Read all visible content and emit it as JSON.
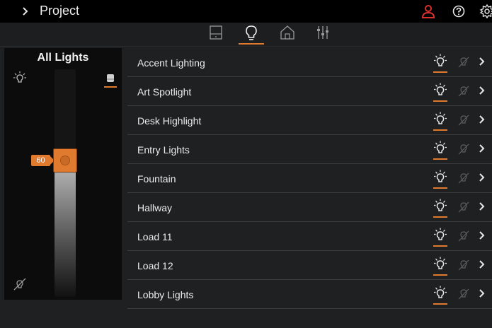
{
  "header": {
    "title": "Project"
  },
  "tabs": [
    {
      "icon": "keypad-icon",
      "active": false
    },
    {
      "icon": "lightbulb-icon",
      "active": true
    },
    {
      "icon": "house-icon",
      "active": false
    },
    {
      "icon": "sliders-icon",
      "active": false
    }
  ],
  "left_panel": {
    "title": "All Lights",
    "level": "60",
    "level_fraction": 0.6
  },
  "lights": [
    {
      "name": "Accent Lighting"
    },
    {
      "name": "Art Spotlight"
    },
    {
      "name": "Desk Highlight"
    },
    {
      "name": "Entry Lights"
    },
    {
      "name": "Fountain"
    },
    {
      "name": "Hallway"
    },
    {
      "name": "Load 11"
    },
    {
      "name": "Load 12"
    },
    {
      "name": "Lobby Lights"
    }
  ],
  "colors": {
    "accent": "#e07a2e",
    "alert": "#d9302e",
    "background": "#1f2022"
  }
}
